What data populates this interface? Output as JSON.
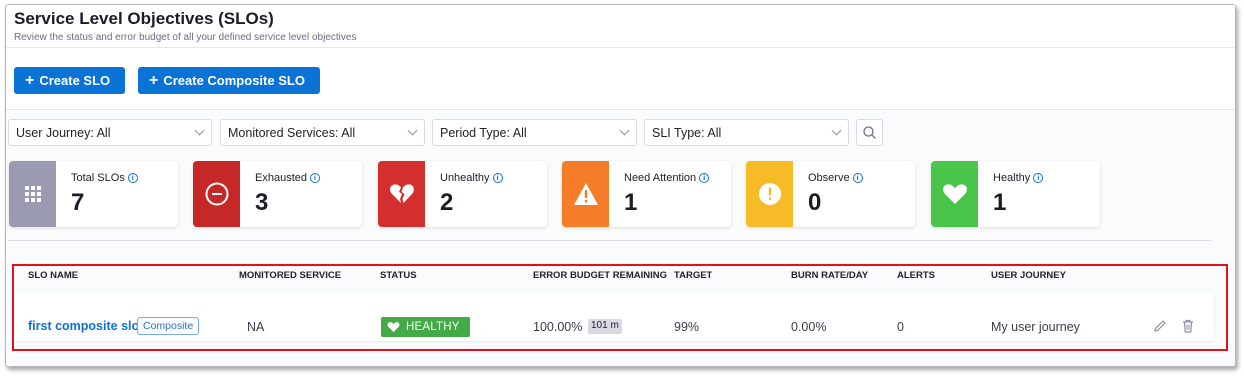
{
  "page": {
    "title": "Service Level Objectives (SLOs)",
    "subtitle": "Review the status and error budget of all your defined service level objectives"
  },
  "actions": {
    "create_slo": "Create SLO",
    "create_composite_slo": "Create Composite SLO"
  },
  "filters": [
    {
      "label": "User Journey: All"
    },
    {
      "label": "Monitored Services: All"
    },
    {
      "label": "Period Type: All"
    },
    {
      "label": "SLI Type: All"
    }
  ],
  "summary_cards": [
    {
      "label": "Total SLOs",
      "value": "7",
      "color": "#9a9bb3",
      "icon": "grid-icon"
    },
    {
      "label": "Exhausted",
      "value": "3",
      "color": "#c62828",
      "icon": "minus-circle-icon"
    },
    {
      "label": "Unhealthy",
      "value": "2",
      "color": "#d32f2f",
      "icon": "broken-heart-icon"
    },
    {
      "label": "Need Attention",
      "value": "1",
      "color": "#f57c28",
      "icon": "warning-icon"
    },
    {
      "label": "Observe",
      "value": "0",
      "color": "#f7bb27",
      "icon": "exclamation-circle-icon"
    },
    {
      "label": "Healthy",
      "value": "1",
      "color": "#49c54c",
      "icon": "heart-icon"
    }
  ],
  "table": {
    "columns": [
      "SLO NAME",
      "MONITORED SERVICE",
      "STATUS",
      "ERROR BUDGET REMAINING",
      "TARGET",
      "BURN RATE/DAY",
      "ALERTS",
      "USER JOURNEY"
    ],
    "rows": [
      {
        "slo_name": "first composite slo",
        "badge": "Composite",
        "monitored_service": "NA",
        "status": "HEALTHY",
        "error_budget": "100.00%",
        "error_budget_time": "101 m",
        "target": "99%",
        "burn_rate": "0.00%",
        "alerts": "0",
        "user_journey": "My user journey"
      }
    ]
  },
  "colors": {
    "primary": "#0b73d6",
    "healthy": "#42ab45",
    "highlight_box": "#e0131c"
  }
}
